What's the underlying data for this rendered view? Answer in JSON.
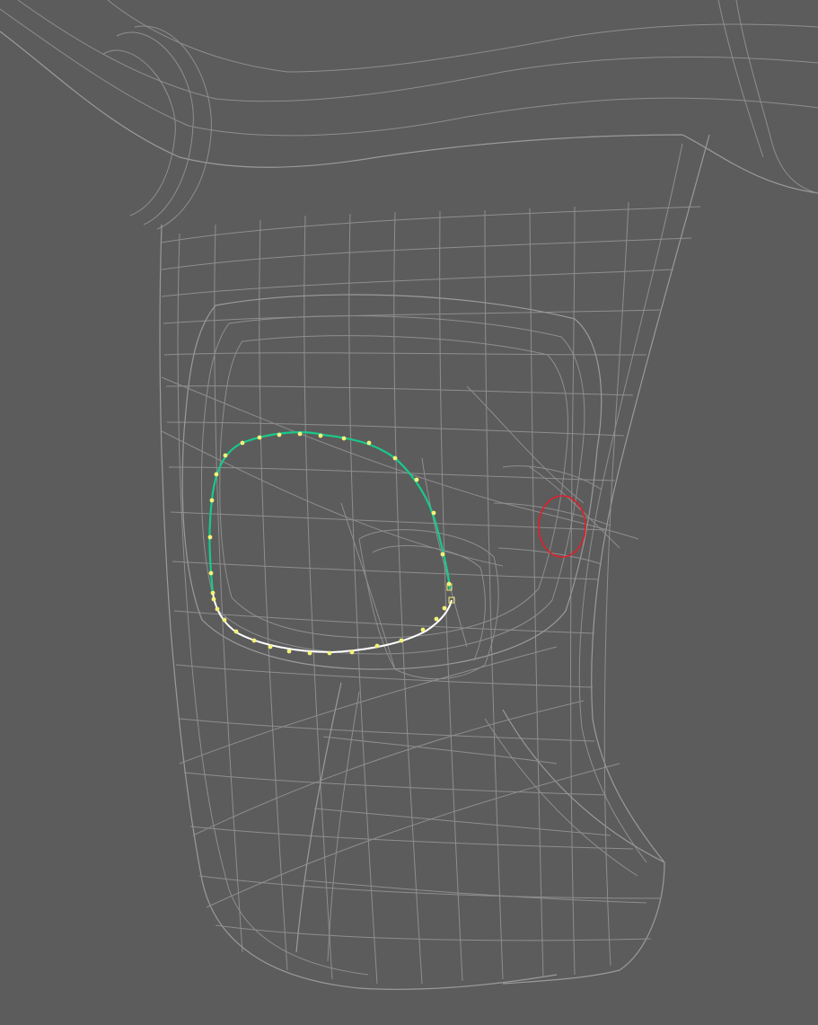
{
  "viewport": {
    "background_color": "#5c5c5c",
    "wire_color": "#8e8e8e"
  },
  "curve": {
    "selected_color": "#19c98a",
    "unselected_color": "#ffffff",
    "cv_color": "#f2f27a"
  },
  "brush_cursor": {
    "color": "#e0202a"
  }
}
